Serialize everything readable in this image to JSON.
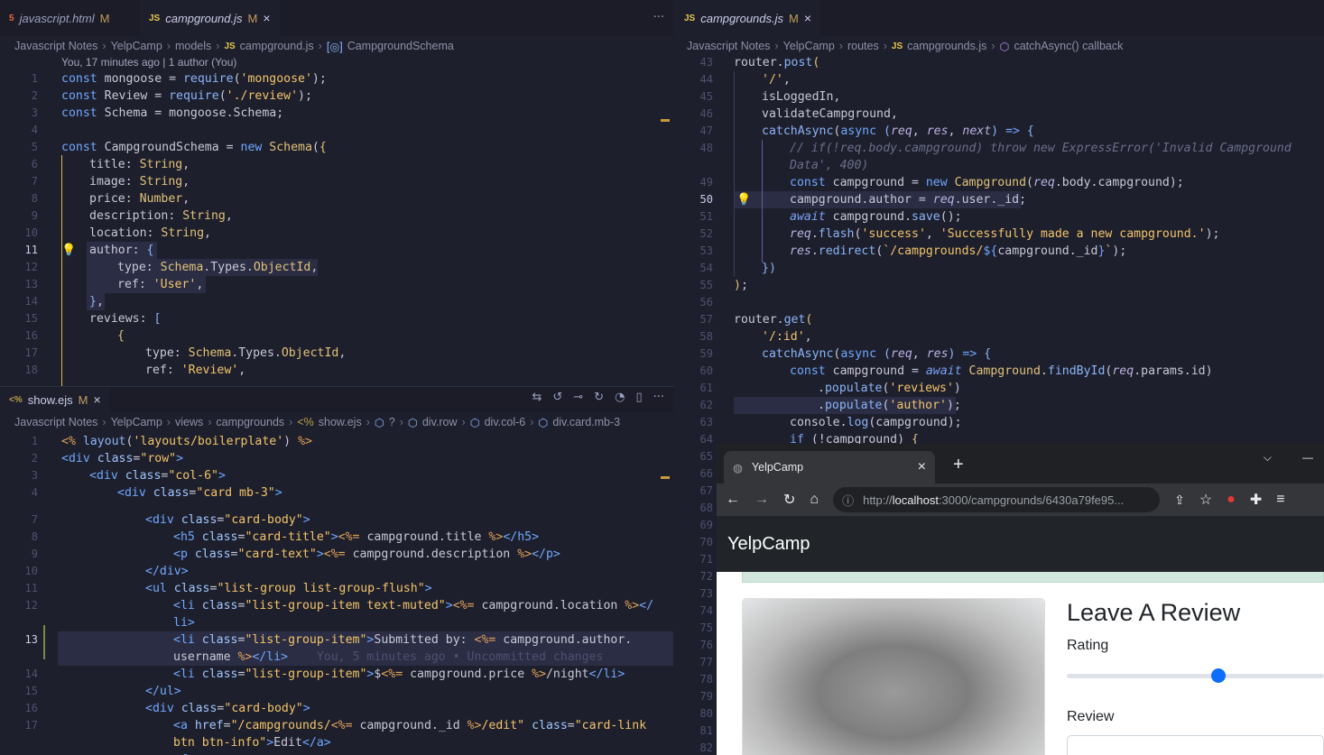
{
  "left_top": {
    "tabs": [
      {
        "icon": "html5-icon",
        "label": "javascript.html",
        "mod": "M"
      },
      {
        "icon": "js-icon",
        "label": "campground.js",
        "mod": "M",
        "close": "×"
      }
    ],
    "more": "···",
    "crumbs": [
      "Javascript Notes",
      "YelpCamp",
      "models",
      "campground.js",
      "CampgroundSchema"
    ],
    "blame": "You, 17 minutes ago | 1 author (You)"
  },
  "right_top": {
    "tab": {
      "label": "campgrounds.js",
      "mod": "M",
      "close": "×"
    },
    "crumbs": [
      "Javascript Notes",
      "YelpCamp",
      "routes",
      "campgrounds.js",
      "catchAsync() callback"
    ]
  },
  "bottom_left": {
    "tab": {
      "label": "show.ejs",
      "mod": "M",
      "close": "×"
    },
    "crumbs": [
      "Javascript Notes",
      "YelpCamp",
      "views",
      "campgrounds",
      "show.ejs",
      "?",
      "div.row",
      "div.col-6",
      "div.card.mb-3"
    ]
  },
  "browser": {
    "tab_title": "YelpCamp",
    "tab_close": "×",
    "new_tab": "+",
    "url_host": "localhost",
    "url_pre": "http://",
    "url_post": ":3000/campgrounds/6430a79fe95...",
    "brand": "YelpCamp",
    "review_heading": "Leave A Review",
    "rating_label": "Rating",
    "rating_value": 0.36,
    "review_label": "Review"
  },
  "colors": {
    "accent": "#0d6efd",
    "nav": "#212529",
    "editor_bg": "#1e1f2c"
  }
}
